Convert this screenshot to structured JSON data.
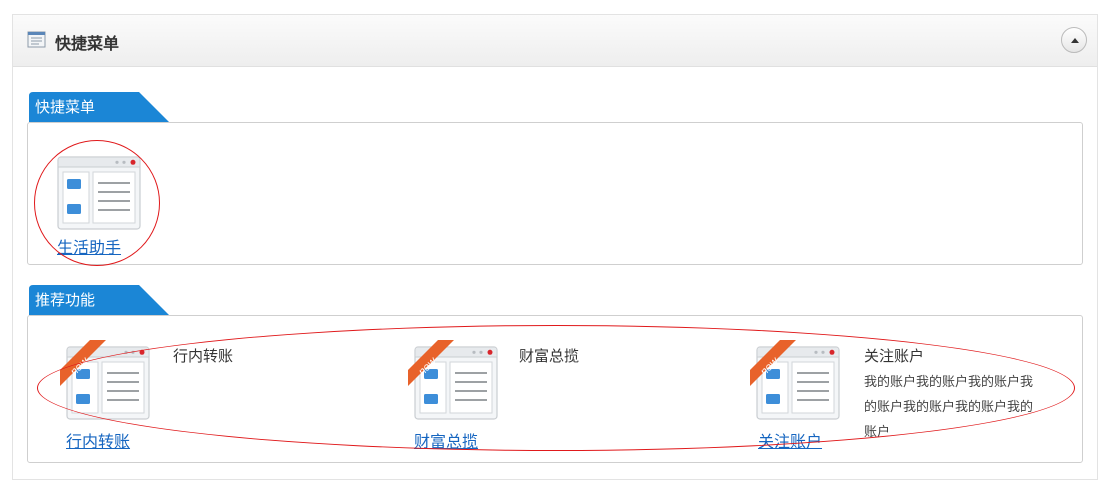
{
  "header": {
    "title": "快捷菜单",
    "icon": "list-window-icon",
    "collapse_icon": "chevron-up-icon"
  },
  "quick_menu": {
    "tab_label": "快捷菜单",
    "items": [
      {
        "label": "生活助手",
        "icon": "app-window-icon"
      }
    ]
  },
  "recommended": {
    "tab_label": "推荐功能",
    "items": [
      {
        "label": "行内转账",
        "title": "行内转账",
        "desc": "",
        "badge": "new",
        "icon": "app-window-icon"
      },
      {
        "label": "财富总揽",
        "title": "财富总揽",
        "desc": "",
        "badge": "new",
        "icon": "app-window-icon"
      },
      {
        "label": "关注账户",
        "title": "关注账户",
        "desc": "我的账户我的账户我的账户我的账户我的账户我的账户我的账户",
        "badge": "new",
        "icon": "app-window-icon"
      }
    ]
  },
  "colors": {
    "tab_blue": "#1b86d6",
    "link_blue": "#1565c0",
    "badge_orange": "#e8622a",
    "annotation_red": "#e0191b"
  }
}
